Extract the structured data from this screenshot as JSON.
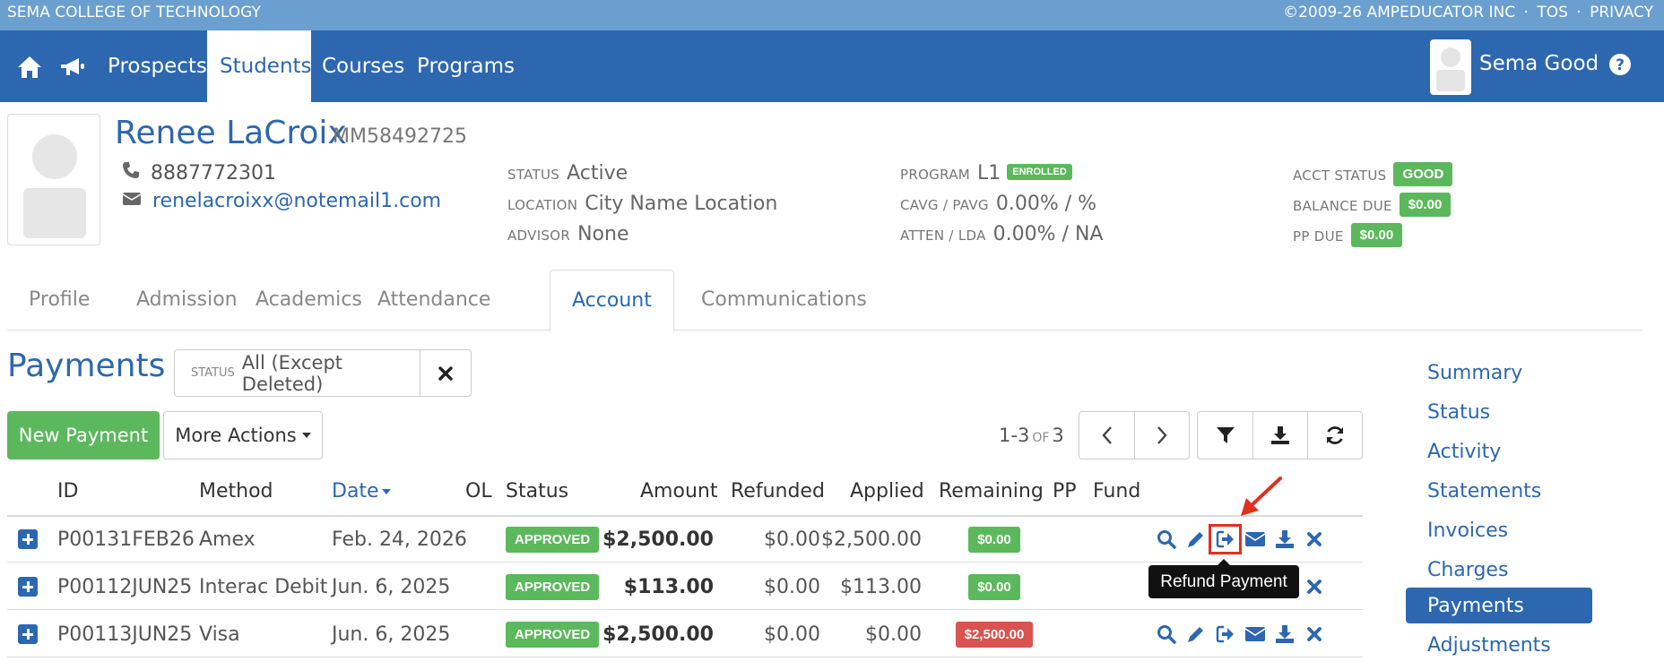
{
  "topbar": {
    "college": "SEMA COLLEGE OF TECHNOLOGY",
    "copyright": "©2009-26 AMPEDUCATOR INC",
    "sep1": "·",
    "tos": "TOS",
    "sep2": "·",
    "privacy": "PRIVACY"
  },
  "nav": {
    "icons": [
      "home-icon",
      "megaphone-icon"
    ],
    "tabs": [
      {
        "label": "Prospects"
      },
      {
        "label": "Students"
      },
      {
        "label": "Courses"
      },
      {
        "label": "Programs"
      }
    ],
    "active_tab": "Students",
    "user_name": "Sema Good",
    "help_icon": "question-circle-icon"
  },
  "student": {
    "name": "Renee LaCroix",
    "id": "MM58492725",
    "phone": "8887772301",
    "email": "renelacroixx@notemail1.com",
    "status_label": "STATUS",
    "status": "Active",
    "location_label": "LOCATION",
    "location": "City Name Location",
    "advisor_label": "ADVISOR",
    "advisor": "None",
    "program_label": "PROGRAM",
    "program": "L1",
    "program_badge": "ENROLLED",
    "cavg_label": "CAVG / PAVG",
    "cavg": "0.00% / %",
    "atten_label": "ATTEN / LDA",
    "atten": "0.00% / NA",
    "acct_status_label": "ACCT STATUS",
    "acct_status": "GOOD",
    "balance_due_label": "BALANCE DUE",
    "balance_due": "$0.00",
    "pp_due_label": "PP DUE",
    "pp_due": "$0.00"
  },
  "tabs": [
    {
      "label": "Profile"
    },
    {
      "label": "Admission"
    },
    {
      "label": "Academics"
    },
    {
      "label": "Attendance"
    },
    {
      "label": "Account"
    },
    {
      "label": "Communications"
    }
  ],
  "active_tab": "Account",
  "payments": {
    "title": "Payments",
    "filter_label": "STATUS",
    "filter_value": "All (Except Deleted)",
    "new_button": "New Payment",
    "more_actions": "More Actions",
    "pager": {
      "range": "1-3",
      "of": "OF",
      "total": "3"
    },
    "columns": {
      "id": "ID",
      "method": "Method",
      "date": "Date",
      "ol": "OL",
      "status": "Status",
      "amount": "Amount",
      "refunded": "Refunded",
      "applied": "Applied",
      "remaining": "Remaining",
      "pp": "PP",
      "fund": "Fund"
    },
    "sort_column": "Date",
    "sort_direction": "descending",
    "rows": [
      {
        "id": "P00131FEB26",
        "method": "Amex",
        "date": "Feb. 24, 2026",
        "status": "APPROVED",
        "amount": "$2,500.00",
        "refunded": "$0.00",
        "applied": "$2,500.00",
        "remaining": "$0.00",
        "remaining_color": "#5cb85c"
      },
      {
        "id": "P00112JUN25",
        "method": "Interac Debit",
        "date": "Jun. 6, 2025",
        "status": "APPROVED",
        "amount": "$113.00",
        "refunded": "$0.00",
        "applied": "$113.00",
        "remaining": "$0.00",
        "remaining_color": "#5cb85c"
      },
      {
        "id": "P00113JUN25",
        "method": "Visa",
        "date": "Jun. 6, 2025",
        "status": "APPROVED",
        "amount": "$2,500.00",
        "refunded": "$0.00",
        "applied": "$0.00",
        "remaining": "$2,500.00",
        "remaining_color": "#d9534f"
      }
    ],
    "row_action_icons": [
      "search-icon",
      "pencil-icon",
      "refund-icon",
      "envelope-icon",
      "download-icon",
      "delete-icon"
    ],
    "tooltip": "Refund Payment"
  },
  "sidebar": {
    "items": [
      {
        "label": "Summary"
      },
      {
        "label": "Status"
      },
      {
        "label": "Activity"
      },
      {
        "label": "Statements"
      },
      {
        "label": "Invoices"
      },
      {
        "label": "Charges"
      },
      {
        "label": "Payments"
      },
      {
        "label": "Adjustments"
      }
    ],
    "active": "Payments"
  },
  "colors": {
    "primary": "#2d67b0",
    "topstrip": "#6b9fd0",
    "success": "#5cb85c",
    "danger": "#d9534f",
    "highlight": "#e0301e"
  }
}
